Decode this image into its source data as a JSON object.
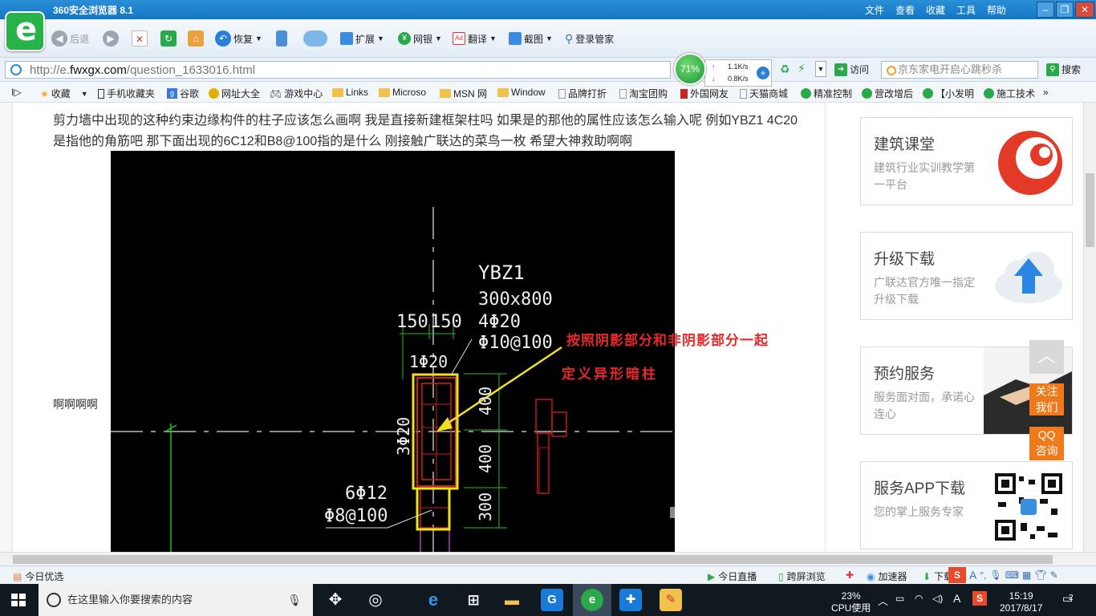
{
  "window": {
    "title": "360安全浏览器 8.1",
    "menus": [
      "文件",
      "查看",
      "收藏",
      "工具",
      "帮助"
    ],
    "controls": {
      "minimize": "–",
      "maximize": "❐",
      "close": "✕"
    }
  },
  "toolbar": {
    "back": "后退",
    "restore": "恢复",
    "extend": "扩展",
    "netbank": "网银",
    "translate": "翻译",
    "screenshot": "截图",
    "login_manager": "登录管家"
  },
  "address": {
    "url_prefix": "http://e.",
    "url_domain": "fwxgx.com",
    "url_path": "/question_1633016.html",
    "speed_percent": "71%",
    "speed_up": "1.1K/s",
    "speed_down": "0.8K/s",
    "visit": "访问",
    "search_placeholder": "京东家电开启心跳秒杀",
    "search_button": "搜索"
  },
  "bookmarks": [
    "收藏",
    "手机收藏夹",
    "谷歌",
    "网址大全",
    "游戏中心",
    "Links",
    "Microso",
    "MSN 网",
    "Window",
    "品牌打折",
    "淘宝团购",
    "外国网友",
    "天猫商城",
    "精准控制",
    "营改增后",
    "【小发明",
    "施工技术"
  ],
  "page": {
    "question": "剪力墙中出现的这种约束边缘构件的柱子应该怎么画啊 我是直接新建框架柱吗 如果是的那他的属性应该怎么输入呢 例如YBZ1 4C20是指他的角筋吧 那下面出现的6C12和B8@100指的是什么 刚接触广联达的菜鸟一枚 希望大神救助啊啊",
    "trailing": "啊啊啊啊",
    "cad": {
      "name": "YBZ1",
      "size": "300x800",
      "rebar_main": "4Φ20",
      "stirrup_top": "Φ10@100",
      "dim_a": "150",
      "dim_b": "150",
      "rebar_1": "1Φ20",
      "rebar_3": "3Φ20",
      "rebar_6": "6Φ12",
      "stirrup_bottom": "Φ8@100",
      "dim_400a": "400",
      "dim_400b": "400",
      "dim_300": "300",
      "annotation_line1": "按照阴影部分和非阴影部分一起",
      "annotation_line2": "定义异形暗柱"
    }
  },
  "sidebar": {
    "cards": [
      {
        "title": "建筑课堂",
        "sub": "建筑行业实训教学第一平台"
      },
      {
        "title": "升级下载",
        "sub": "广联达官方唯一指定升级下载"
      },
      {
        "title": "预约服务",
        "sub": "服务面对面，承诺心连心"
      },
      {
        "title": "服务APP下载",
        "sub": "您的掌上服务专家"
      }
    ],
    "float_follow": "关注我们",
    "float_qq": "QQ咨询"
  },
  "statusbar": {
    "today_pick": "今日优选",
    "today_live": "今日直播",
    "cross_screen": "跨屏浏览",
    "accelerator": "加速器",
    "download": "下载"
  },
  "taskbar": {
    "search_placeholder": "在这里输入你要搜索的内容",
    "cpu_percent": "23%",
    "cpu_label": "CPU使用",
    "time": "15:19",
    "date": "2017/8/17",
    "notifications": "2",
    "ime": "A"
  },
  "colors": {
    "titlebar": "#1477c4",
    "cad_background": "#000000",
    "annotation_red": "#e8282a",
    "highlight_yellow": "#f0e21a",
    "accent_orange": "#f07a1a"
  }
}
